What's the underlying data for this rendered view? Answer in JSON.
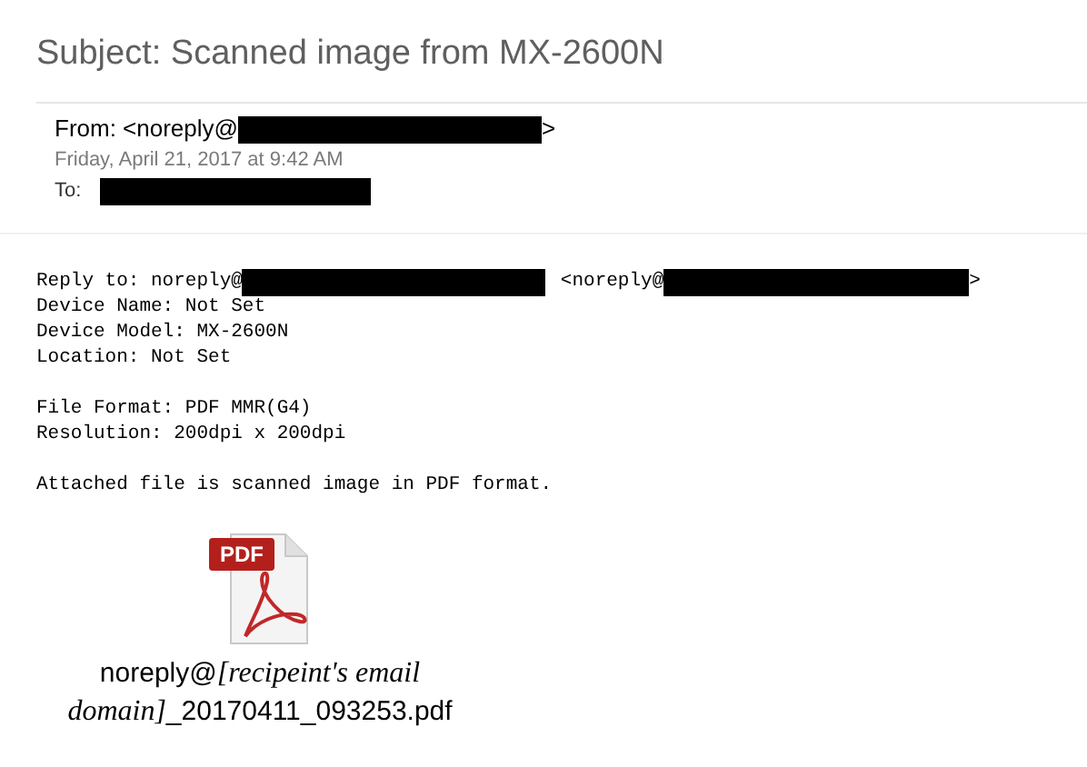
{
  "subject": "Subject: Scanned image from MX-2600N",
  "from": {
    "prefix": "From: <noreply@",
    "suffix": ">",
    "redacted": true
  },
  "date": "Friday, April 21, 2017 at 9:42 AM",
  "to": {
    "label": "To:",
    "redacted": true
  },
  "body": {
    "reply_to": {
      "prefix": "Reply to: noreply@",
      "middle": "<noreply@",
      "suffix": ">",
      "redacted": true
    },
    "paragraphs": [
      [
        "Device Name: Not Set",
        "Device Model: MX-2600N",
        "Location: Not Set"
      ],
      [
        "File Format: PDF MMR(G4)",
        "Resolution: 200dpi x 200dpi"
      ],
      [
        "Attached file is scanned image in PDF format."
      ]
    ]
  },
  "attachment": {
    "icon_label": "PDF",
    "file_name": [
      {
        "kind": "literal",
        "text": "noreply@"
      },
      {
        "kind": "placeholder",
        "text": "[recipeint's email domain]"
      },
      {
        "kind": "literal",
        "text": "_20170411_093253.pdf"
      }
    ]
  }
}
